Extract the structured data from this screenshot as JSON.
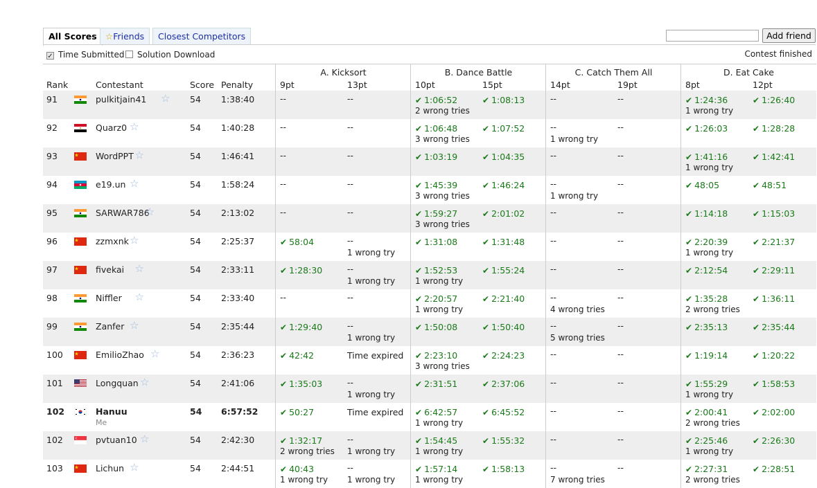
{
  "tabs": {
    "all": "All Scores",
    "friends": "Friends",
    "closest": "Closest Competitors"
  },
  "add_friend": "Add friend",
  "options": {
    "time": "Time Submitted",
    "solution": "Solution Download"
  },
  "status": "Contest finished",
  "header": {
    "rank": "Rank",
    "contestant": "Contestant",
    "score": "Score",
    "penalty": "Penalty",
    "problems": [
      {
        "name": "A. Kicksort",
        "pts": [
          "9pt",
          "13pt"
        ]
      },
      {
        "name": "B. Dance Battle",
        "pts": [
          "10pt",
          "15pt"
        ]
      },
      {
        "name": "C. Catch Them All",
        "pts": [
          "14pt",
          "19pt"
        ]
      },
      {
        "name": "D. Eat Cake",
        "pts": [
          "8pt",
          "12pt"
        ]
      }
    ]
  },
  "rows": [
    {
      "rank": "91",
      "flag": "in",
      "name": "pulkitjain41",
      "score": "54",
      "penalty": "1:38:40",
      "c": [
        [
          "--",
          ""
        ],
        [
          "--",
          ""
        ],
        [
          "1:06:52",
          "2 wrong tries"
        ],
        [
          "1:08:13",
          ""
        ],
        [
          "--",
          ""
        ],
        [
          "--",
          ""
        ],
        [
          "1:24:36",
          "1 wrong try"
        ],
        [
          "1:26:40",
          ""
        ]
      ],
      "ok": [
        0,
        0,
        1,
        1,
        0,
        0,
        1,
        1
      ]
    },
    {
      "rank": "92",
      "flag": "eg",
      "name": "Quarz0",
      "score": "54",
      "penalty": "1:40:28",
      "c": [
        [
          "--",
          ""
        ],
        [
          "--",
          ""
        ],
        [
          "1:06:48",
          "3 wrong tries"
        ],
        [
          "1:07:52",
          ""
        ],
        [
          "--",
          "1 wrong try"
        ],
        [
          "--",
          ""
        ],
        [
          "1:26:03",
          ""
        ],
        [
          "1:28:28",
          ""
        ]
      ],
      "ok": [
        0,
        0,
        1,
        1,
        0,
        0,
        1,
        1
      ]
    },
    {
      "rank": "93",
      "flag": "cn",
      "name": "WordPPT",
      "score": "54",
      "penalty": "1:46:41",
      "c": [
        [
          "--",
          ""
        ],
        [
          "--",
          ""
        ],
        [
          "1:03:19",
          ""
        ],
        [
          "1:04:35",
          ""
        ],
        [
          "--",
          ""
        ],
        [
          "--",
          ""
        ],
        [
          "1:41:16",
          "1 wrong try"
        ],
        [
          "1:42:41",
          ""
        ]
      ],
      "ok": [
        0,
        0,
        1,
        1,
        0,
        0,
        1,
        1
      ]
    },
    {
      "rank": "94",
      "flag": "az",
      "name": "e19.un",
      "score": "54",
      "penalty": "1:58:24",
      "c": [
        [
          "--",
          ""
        ],
        [
          "--",
          ""
        ],
        [
          "1:45:39",
          "3 wrong tries"
        ],
        [
          "1:46:24",
          ""
        ],
        [
          "--",
          "1 wrong try"
        ],
        [
          "--",
          ""
        ],
        [
          "48:05",
          ""
        ],
        [
          "48:51",
          ""
        ]
      ],
      "ok": [
        0,
        0,
        1,
        1,
        0,
        0,
        1,
        1
      ]
    },
    {
      "rank": "95",
      "flag": "in",
      "name": "SARWAR786",
      "score": "54",
      "penalty": "2:13:02",
      "c": [
        [
          "--",
          ""
        ],
        [
          "--",
          ""
        ],
        [
          "1:59:27",
          "3 wrong tries"
        ],
        [
          "2:01:02",
          ""
        ],
        [
          "--",
          ""
        ],
        [
          "--",
          ""
        ],
        [
          "1:14:18",
          ""
        ],
        [
          "1:15:03",
          ""
        ]
      ],
      "ok": [
        0,
        0,
        1,
        1,
        0,
        0,
        1,
        1
      ]
    },
    {
      "rank": "96",
      "flag": "cn",
      "name": "zzmxnk",
      "score": "54",
      "penalty": "2:25:37",
      "c": [
        [
          "58:04",
          ""
        ],
        [
          "--",
          "1 wrong try"
        ],
        [
          "1:31:08",
          ""
        ],
        [
          "1:31:48",
          ""
        ],
        [
          "--",
          ""
        ],
        [
          "--",
          ""
        ],
        [
          "2:20:39",
          "1 wrong try"
        ],
        [
          "2:21:37",
          ""
        ]
      ],
      "ok": [
        1,
        0,
        1,
        1,
        0,
        0,
        1,
        1
      ]
    },
    {
      "rank": "97",
      "flag": "cn",
      "name": "fivekai",
      "score": "54",
      "penalty": "2:33:11",
      "c": [
        [
          "1:28:30",
          ""
        ],
        [
          "--",
          "1 wrong try"
        ],
        [
          "1:52:53",
          "1 wrong try"
        ],
        [
          "1:55:24",
          ""
        ],
        [
          "--",
          ""
        ],
        [
          "--",
          ""
        ],
        [
          "2:12:54",
          ""
        ],
        [
          "2:29:11",
          ""
        ]
      ],
      "ok": [
        1,
        0,
        1,
        1,
        0,
        0,
        1,
        1
      ]
    },
    {
      "rank": "98",
      "flag": "in",
      "name": "Niffler",
      "score": "54",
      "penalty": "2:33:40",
      "c": [
        [
          "--",
          ""
        ],
        [
          "--",
          ""
        ],
        [
          "2:20:57",
          "1 wrong try"
        ],
        [
          "2:21:40",
          ""
        ],
        [
          "--",
          "4 wrong tries"
        ],
        [
          "--",
          ""
        ],
        [
          "1:35:28",
          "2 wrong tries"
        ],
        [
          "1:36:11",
          ""
        ]
      ],
      "ok": [
        0,
        0,
        1,
        1,
        0,
        0,
        1,
        1
      ]
    },
    {
      "rank": "99",
      "flag": "in",
      "name": "Zanfer",
      "score": "54",
      "penalty": "2:35:44",
      "c": [
        [
          "1:29:40",
          ""
        ],
        [
          "--",
          "1 wrong try"
        ],
        [
          "1:50:08",
          ""
        ],
        [
          "1:50:40",
          ""
        ],
        [
          "--",
          "5 wrong tries"
        ],
        [
          "--",
          ""
        ],
        [
          "2:35:13",
          ""
        ],
        [
          "2:35:44",
          ""
        ]
      ],
      "ok": [
        1,
        0,
        1,
        1,
        0,
        0,
        1,
        1
      ]
    },
    {
      "rank": "100",
      "flag": "cn",
      "name": "EmilioZhao",
      "score": "54",
      "penalty": "2:36:23",
      "c": [
        [
          "42:42",
          ""
        ],
        [
          "Time expired",
          ""
        ],
        [
          "2:23:10",
          "3 wrong tries"
        ],
        [
          "2:24:23",
          ""
        ],
        [
          "--",
          ""
        ],
        [
          "--",
          ""
        ],
        [
          "1:19:14",
          ""
        ],
        [
          "1:20:22",
          ""
        ]
      ],
      "ok": [
        1,
        0,
        1,
        1,
        0,
        0,
        1,
        1
      ]
    },
    {
      "rank": "101",
      "flag": "us",
      "name": "Longquan",
      "score": "54",
      "penalty": "2:41:06",
      "c": [
        [
          "1:35:03",
          ""
        ],
        [
          "--",
          "1 wrong try"
        ],
        [
          "2:31:51",
          ""
        ],
        [
          "2:37:06",
          ""
        ],
        [
          "--",
          ""
        ],
        [
          "--",
          ""
        ],
        [
          "1:55:29",
          "1 wrong try"
        ],
        [
          "1:58:53",
          ""
        ]
      ],
      "ok": [
        1,
        0,
        1,
        1,
        0,
        0,
        1,
        1
      ]
    },
    {
      "rank": "102",
      "flag": "kr",
      "name": "Hanuu",
      "me": "Me",
      "score": "54",
      "penalty": "6:57:52",
      "c": [
        [
          "50:27",
          ""
        ],
        [
          "Time expired",
          ""
        ],
        [
          "6:42:57",
          "1 wrong try"
        ],
        [
          "6:45:52",
          ""
        ],
        [
          "--",
          ""
        ],
        [
          "--",
          ""
        ],
        [
          "2:00:41",
          "2 wrong tries"
        ],
        [
          "2:02:00",
          ""
        ]
      ],
      "ok": [
        1,
        0,
        1,
        1,
        0,
        0,
        1,
        1
      ]
    },
    {
      "rank": "102",
      "flag": "sg",
      "name": "pvtuan10",
      "score": "54",
      "penalty": "2:42:30",
      "c": [
        [
          "1:32:17",
          "2 wrong tries"
        ],
        [
          "--",
          "1 wrong try"
        ],
        [
          "1:54:45",
          "1 wrong try"
        ],
        [
          "1:55:32",
          ""
        ],
        [
          "--",
          ""
        ],
        [
          "--",
          ""
        ],
        [
          "2:25:46",
          "1 wrong try"
        ],
        [
          "2:26:30",
          ""
        ]
      ],
      "ok": [
        1,
        0,
        1,
        1,
        0,
        0,
        1,
        1
      ]
    },
    {
      "rank": "103",
      "flag": "cn",
      "name": "Lichun",
      "score": "54",
      "penalty": "2:44:51",
      "c": [
        [
          "40:43",
          "1 wrong try"
        ],
        [
          "--",
          "1 wrong try"
        ],
        [
          "1:57:14",
          "1 wrong try"
        ],
        [
          "1:58:13",
          ""
        ],
        [
          "--",
          "7 wrong tries"
        ],
        [
          "--",
          ""
        ],
        [
          "2:27:31",
          "2 wrong tries"
        ],
        [
          "2:28:51",
          ""
        ]
      ],
      "ok": [
        1,
        0,
        1,
        1,
        0,
        0,
        1,
        1
      ]
    }
  ],
  "colors": {
    "check": "#1a7a1a",
    "link": "#1c2fa5",
    "alt_row": "#eeeeee"
  }
}
